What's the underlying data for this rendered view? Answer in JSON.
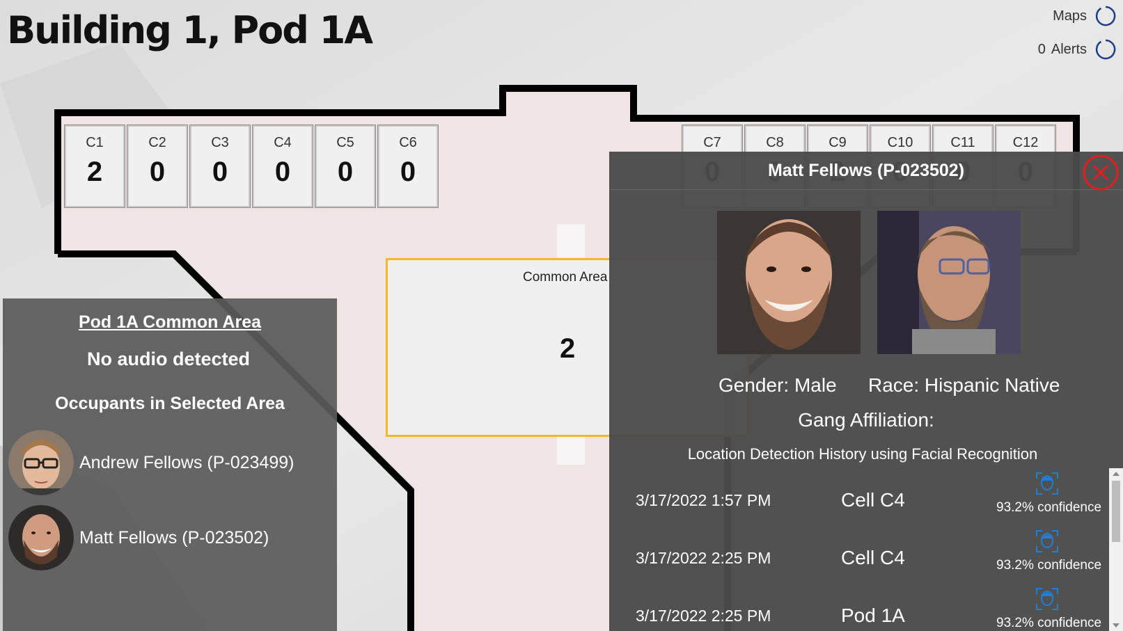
{
  "page": {
    "title": "Building 1, Pod 1A"
  },
  "top_controls": {
    "maps_label": "Maps",
    "alerts_count": "0",
    "alerts_label": "Alerts",
    "icon": "refresh-icon"
  },
  "cells_left": [
    {
      "label": "C1",
      "count": "2"
    },
    {
      "label": "C2",
      "count": "0"
    },
    {
      "label": "C3",
      "count": "0"
    },
    {
      "label": "C4",
      "count": "0"
    },
    {
      "label": "C5",
      "count": "0"
    },
    {
      "label": "C6",
      "count": "0"
    }
  ],
  "cells_right": [
    {
      "label": "C7",
      "count": "0"
    },
    {
      "label": "C8",
      "count": "0"
    },
    {
      "label": "C9",
      "count": "2"
    },
    {
      "label": "C10",
      "count": "0"
    },
    {
      "label": "C11",
      "count": "0"
    },
    {
      "label": "C12",
      "count": "0"
    }
  ],
  "common_area": {
    "label": "Common Area",
    "count": "2"
  },
  "left_panel": {
    "title": "Pod 1A Common Area",
    "audio_status": "No audio detected",
    "occupants_heading": "Occupants in Selected Area",
    "occupants": [
      {
        "name": "Andrew Fellows (P-023499)"
      },
      {
        "name": "Matt Fellows (P-023502)"
      }
    ]
  },
  "detail": {
    "name": "Matt Fellows (P-023502)",
    "gender": "Gender: Male",
    "race": "Race: Hispanic Native",
    "gang": "Gang Affiliation:",
    "history_heading": "Location Detection History using Facial Recognition",
    "history": [
      {
        "time": "3/17/2022 1:57 PM",
        "location": "Cell C4",
        "confidence": "93.2% confidence"
      },
      {
        "time": "3/17/2022 2:25 PM",
        "location": "Cell C4",
        "confidence": "93.2% confidence"
      },
      {
        "time": "3/17/2022 2:25 PM",
        "location": "Pod 1A",
        "confidence": "93.2% confidence"
      }
    ]
  },
  "colors": {
    "accent_blue": "#1e7fd8",
    "common_area_border": "#f3b72c",
    "close_red": "#e11d1d",
    "panel_dark": "#4b4b4b"
  }
}
